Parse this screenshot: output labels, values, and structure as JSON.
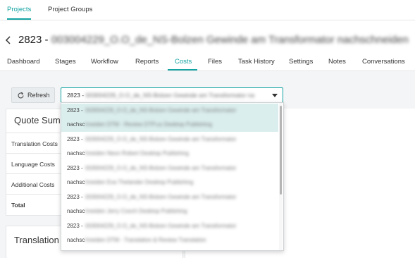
{
  "topnav": {
    "tabs": [
      "Projects",
      "Project Groups"
    ],
    "active": "Projects"
  },
  "header": {
    "id": "2823 -",
    "title_blurred": "003004229_O.O_de_NS-Bolzen Gewinde am Transformator nachschneiden"
  },
  "subnav": {
    "tabs": [
      "Dashboard",
      "Stages",
      "Workflow",
      "Reports",
      "Costs",
      "Files",
      "Task History",
      "Settings",
      "Notes",
      "Conversations"
    ],
    "active": "Costs"
  },
  "toolbar": {
    "refresh_label": "Refresh",
    "select_prefix": "2823 -",
    "select_blurred": "003004229_O.O_de_NS-Bolzen Gewinde am Transformator na"
  },
  "quote_summary": {
    "title": "Quote Sum",
    "rows": [
      "Translation Costs",
      "Language Costs",
      "Additional Costs",
      "Total"
    ]
  },
  "translation_card": {
    "title": "Translation"
  },
  "dropdown": {
    "items": [
      {
        "prefix": "2823 -",
        "text": "003004229_O.O_de_NS-Bolzen Gewinde am Transformator"
      },
      {
        "prefix": "nachsc",
        "text": "hneiden DTM - Review DTP.us Desktop Publishing"
      },
      {
        "prefix": "2823 -",
        "text": "003004229_O.O_de_NS-Bolzen Gewinde am Transformator"
      },
      {
        "prefix": "nachsc",
        "text": "hneiden Neon Robert Desktop Publishing"
      },
      {
        "prefix": "2823 -",
        "text": "003004229_O.O_de_NS-Bolzen Gewinde am Transformator"
      },
      {
        "prefix": "nachsc",
        "text": "hneiden Eva Thelander Desktop Publishing"
      },
      {
        "prefix": "2823 -",
        "text": "003004229_O.O_de_NS-Bolzen Gewinde am Transformator"
      },
      {
        "prefix": "nachsc",
        "text": "hneiden Jerry Cooch Desktop Publishing"
      },
      {
        "prefix": "2823 -",
        "text": "003004229_O.O_de_NS-Bolzen Gewinde am Transformator"
      },
      {
        "prefix": "nachsc",
        "text": "hneiden DTM - Translation & Review Translation"
      }
    ]
  },
  "colors": {
    "accent": "#14a3a3",
    "selected_row": "#dbeeee"
  }
}
